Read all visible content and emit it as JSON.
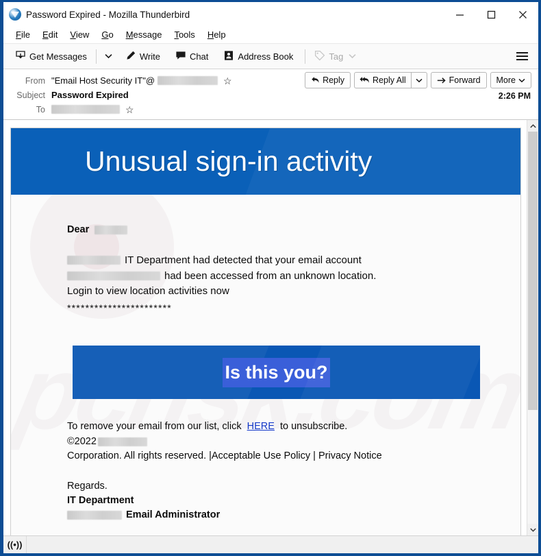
{
  "window": {
    "title": "Password Expired - Mozilla Thunderbird",
    "app_icon": "thunderbird-icon",
    "minimize_label": "Minimize",
    "maximize_label": "Maximize",
    "close_label": "Close"
  },
  "menubar": {
    "items": [
      {
        "label": "File",
        "accel": "F"
      },
      {
        "label": "Edit",
        "accel": "E"
      },
      {
        "label": "View",
        "accel": "V"
      },
      {
        "label": "Go",
        "accel": "G"
      },
      {
        "label": "Message",
        "accel": "M"
      },
      {
        "label": "Tools",
        "accel": "T"
      },
      {
        "label": "Help",
        "accel": "H"
      }
    ]
  },
  "toolbar": {
    "get_messages": "Get Messages",
    "write": "Write",
    "chat": "Chat",
    "address_book": "Address Book",
    "tag": "Tag",
    "app_menu": "Application Menu"
  },
  "message_header": {
    "from_label": "From",
    "from_value": "\"Email Host Security IT\"@",
    "from_redacted": true,
    "subject_label": "Subject",
    "subject_value": "Password Expired",
    "to_label": "To",
    "to_redacted": true,
    "timestamp": "2:26 PM",
    "actions": {
      "reply": "Reply",
      "reply_all": "Reply All",
      "forward": "Forward",
      "more": "More"
    }
  },
  "email": {
    "banner_title": "Unusual sign-in activity",
    "banner_color": "#0a60b8",
    "greeting": "Dear",
    "body_line_1_suffix": "IT Department had detected that your email account",
    "body_line_2_suffix": "had been accessed from an unknown location.",
    "body_line_3": "Login to view location activities now",
    "asterisks": "***********************",
    "cta_label": "Is this you?",
    "cta_color": "#0a57b4",
    "cta_highlight_color": "#3a5fd9",
    "footer_line_1_before": "To remove your email from our list, click",
    "footer_link": "HERE",
    "footer_line_1_after": "to unsubscribe.",
    "footer_copyright": "©2022",
    "footer_line_3": "Corporation. All rights reserved. |Acceptable Use Policy | Privacy Notice",
    "signature_line_1": "Regards.",
    "signature_line_2": "IT Department",
    "signature_line_3": "Email Administrator",
    "link_color": "#1136c8"
  },
  "statusbar": {
    "connection_icon": "((•))"
  }
}
